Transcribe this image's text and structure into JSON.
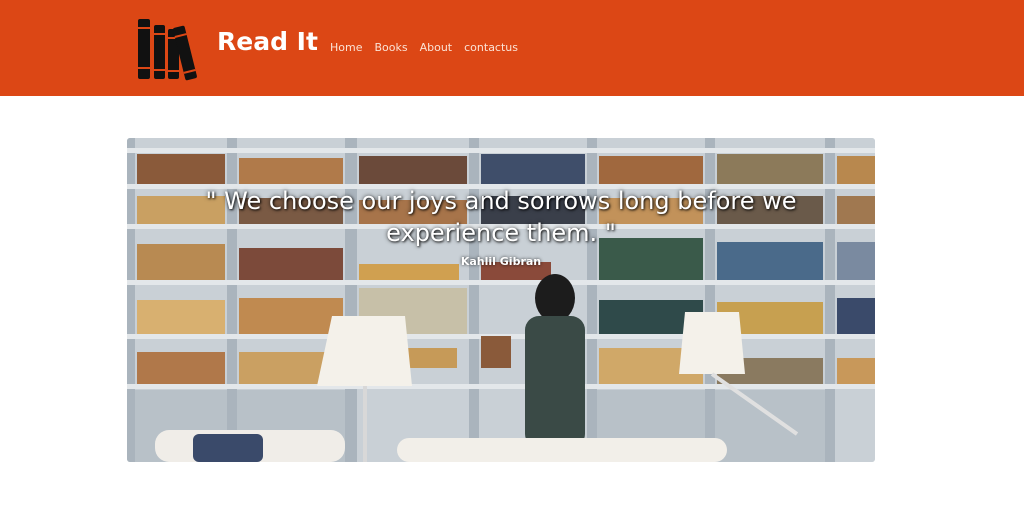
{
  "header": {
    "brand": "Read It",
    "logo_icon": "books-icon",
    "background_color": "#dc4715",
    "nav": [
      {
        "label": "Home"
      },
      {
        "label": "Books"
      },
      {
        "label": "About"
      },
      {
        "label": "contactus"
      }
    ]
  },
  "hero": {
    "quote_line_1": "\" We choose our joys and sorrows long before we",
    "quote_line_2": "experience them. \"",
    "author": "Kahlil Gibran",
    "image_subject": "library-photo"
  }
}
